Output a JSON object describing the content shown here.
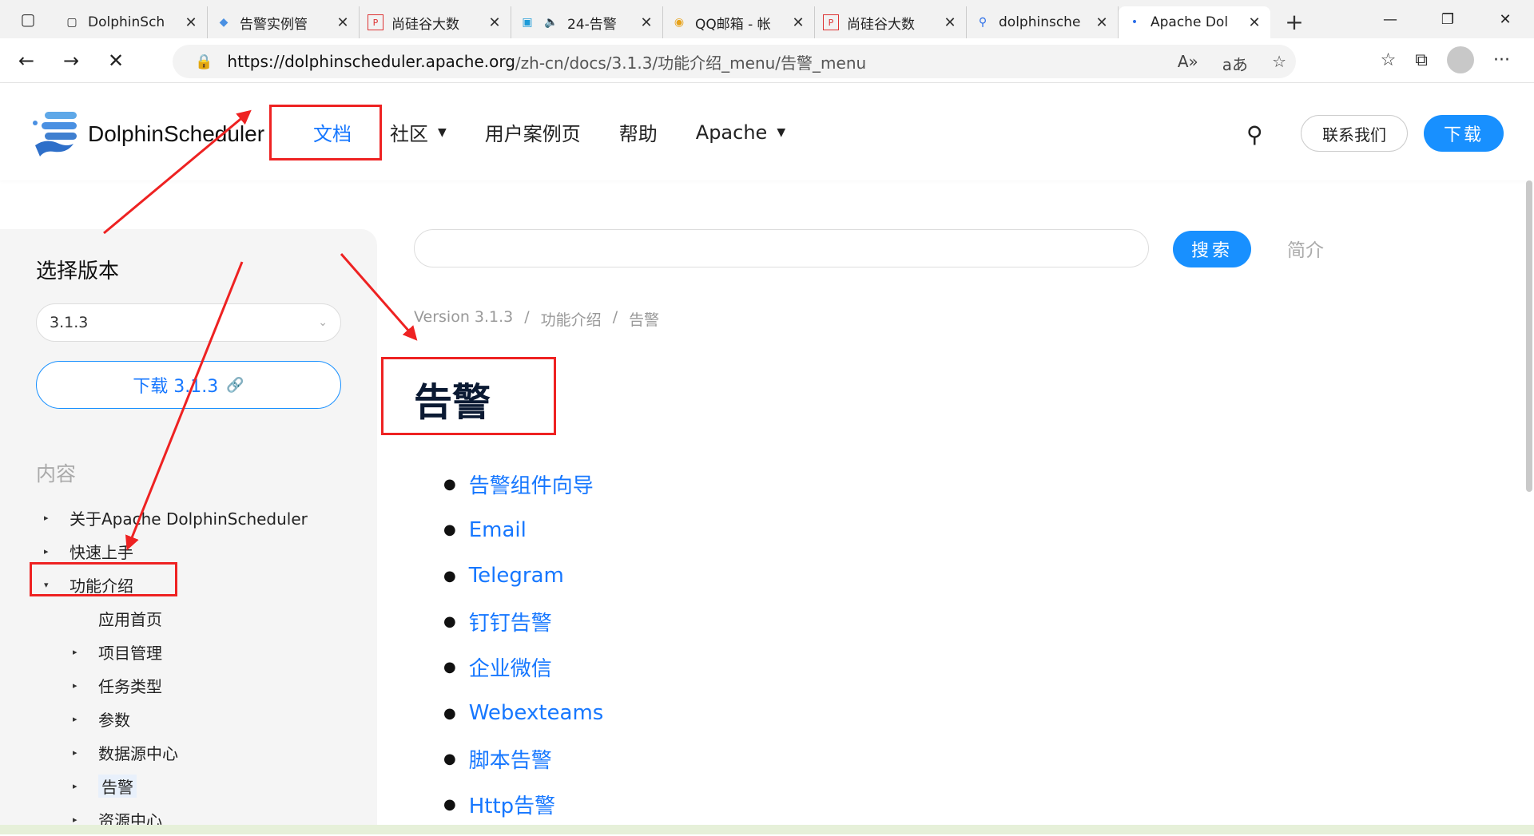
{
  "browser": {
    "tabs": [
      {
        "label": "DolphinSch",
        "icon": "page-icon"
      },
      {
        "label": "告警实例管",
        "icon": "dolphin-icon"
      },
      {
        "label": "尚硅谷大数",
        "icon": "pdf-icon"
      },
      {
        "label": "24-告警",
        "icon": "bilibili-icon"
      },
      {
        "label": "QQ邮箱 - 帐",
        "icon": "qqmail-icon"
      },
      {
        "label": "尚硅谷大数",
        "icon": "pdf-icon"
      },
      {
        "label": "dolphinsche",
        "icon": "search-icon"
      },
      {
        "label": "Apache Dol",
        "icon": "loading-icon"
      }
    ],
    "url_host": "https://dolphinscheduler.apache.org",
    "url_path": "/zh-cn/docs/3.1.3/功能介绍_menu/告警_menu"
  },
  "site": {
    "logo_text": "DolphinScheduler",
    "nav": [
      "文档",
      "社区",
      "用户案例页",
      "帮助",
      "Apache"
    ],
    "contact_label": "联系我们",
    "download_label": "下载"
  },
  "sidebar": {
    "title": "选择版本",
    "version": "3.1.3",
    "download_version_label": "下载 3.1.3",
    "section_label": "内容",
    "tree": [
      {
        "label": "关于Apache DolphinScheduler",
        "level": 1,
        "tri": "▸"
      },
      {
        "label": "快速上手",
        "level": 1,
        "tri": "▸"
      },
      {
        "label": "功能介绍",
        "level": 1,
        "tri": "▾"
      },
      {
        "label": "应用首页",
        "level": 2,
        "tri": ""
      },
      {
        "label": "项目管理",
        "level": 2,
        "tri": "▸"
      },
      {
        "label": "任务类型",
        "level": 2,
        "tri": "▸"
      },
      {
        "label": "参数",
        "level": 2,
        "tri": "▸"
      },
      {
        "label": "数据源中心",
        "level": 2,
        "tri": "▸"
      },
      {
        "label": "告警",
        "level": 2,
        "tri": "▸"
      },
      {
        "label": "资源中心",
        "level": 2,
        "tri": "▸"
      }
    ]
  },
  "main": {
    "search_button": "搜索",
    "intro_link": "简介",
    "breadcrumb": [
      "Version 3.1.3",
      "/",
      "功能介绍",
      "/",
      "告警"
    ],
    "title": "告警",
    "items": [
      "告警组件向导",
      "Email",
      "Telegram",
      "钉钉告警",
      "企业微信",
      "Webexteams",
      "脚本告警",
      "Http告警"
    ]
  },
  "colors": {
    "accent": "#1890ff",
    "link": "#1677ff",
    "annotation": "#ee2222"
  }
}
